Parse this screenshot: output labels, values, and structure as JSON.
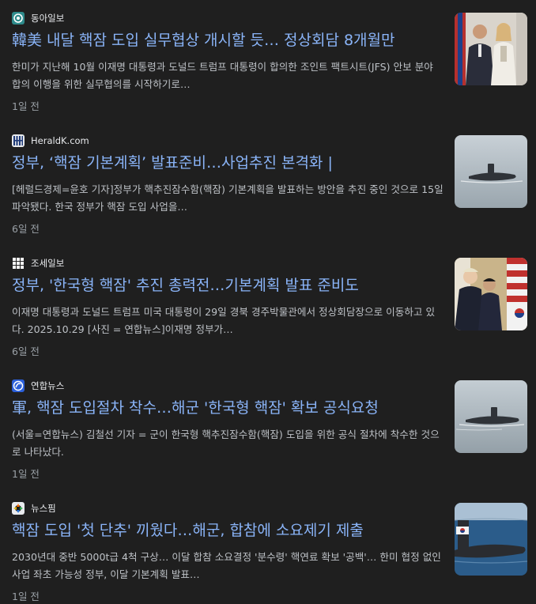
{
  "articles": [
    {
      "source": "동아일보",
      "source_icon": "donga-logo-icon",
      "title": "韓美 내달 핵잠 도입 실무협상 개시할 듯… 정상회담 8개월만",
      "snippet": "한미가 지난해 10월 이재명 대통령과 도널드 트럼프 대통령이 합의한 조인트 팩트시트(JFS) 안보 분야 합의 이행을 위한 실무협의를 시작하기로…",
      "age": "1일 전",
      "thumbnail": "officials-photo"
    },
    {
      "source": "HeraldK.com",
      "source_icon": "heraldk-logo-icon",
      "title": "정부, ‘핵잠 기본계획’ 발표준비…사업추진 본격화 |",
      "snippet": "[헤럴드경제=윤호 기자]정부가 핵추진잠수함(핵잠) 기본계획을 발표하는 방안을 추진 중인 것으로 15일 파악됐다. 한국 정부가 핵잠 도입 사업을…",
      "age": "6일 전",
      "thumbnail": "submarine-photo"
    },
    {
      "source": "조세일보",
      "source_icon": "joseilbo-logo-icon",
      "title": "정부, '한국형 핵잠' 추진 총력전…기본계획 발표 준비도",
      "snippet": "이재명 대통령과 도널드 트럼프 미국 대통령이 29일 경북 경주박물관에서 정상회담장으로 이동하고 있다. 2025.10.29 [사진 = 연합뉴스]이재명 정부가…",
      "age": "6일 전",
      "thumbnail": "leaders-photo"
    },
    {
      "source": "연합뉴스",
      "source_icon": "yonhap-logo-icon",
      "title": "軍, 핵잠 도입절차 착수…해군 '한국형 핵잠' 확보 공식요청",
      "snippet": "(서울=연합뉴스) 김철선 기자 = 군이 한국형 핵추진잠수함(핵잠) 도입을 위한 공식 절차에 착수한 것으로 나타났다.",
      "age": "1일 전",
      "thumbnail": "submarine-photo"
    },
    {
      "source": "뉴스핌",
      "source_icon": "newspim-logo-icon",
      "title": "핵잠 도입 '첫 단추' 끼웠다…해군, 합참에 소요제기 제출",
      "snippet": "2030년대 중반 5000t급 4척 구상… 이달 합참 소요결정 '분수령' 핵연료 확보 '공백'… 한미 협정 없인 사업 좌초 가능성 정부, 이달 기본계획 발표…",
      "age": "1일 전",
      "thumbnail": "submarine-flag-photo"
    }
  ]
}
